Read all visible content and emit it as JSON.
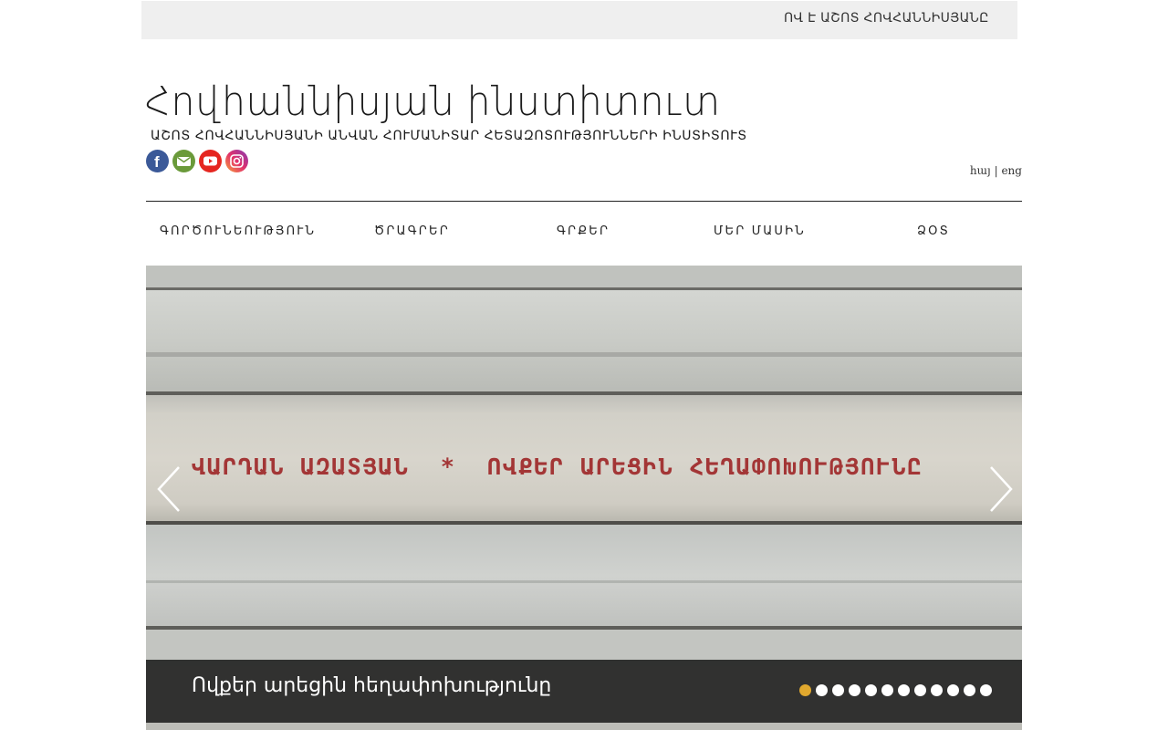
{
  "topbar": {
    "link": "ՈՎ Է ԱՇՈՏ ՀՈՎՀԱՆՆԻՍՅԱՆԸ"
  },
  "header": {
    "title": "Հովհաննիսյան ինստիտուտ",
    "subtitle": "ԱՇՈՏ ՀՈՎՀԱՆՆԻՍՅԱՆԻ ԱՆՎԱՆ ՀՈՒՄԱՆԻՏԱՐ ՀԵՏԱԶՈՏՈՒԹՅՈՒՆՆԵՐԻ ԻՆՍՏԻՏՈՒՏ",
    "social": [
      {
        "icon": "facebook-icon",
        "color": "#3b5998"
      },
      {
        "icon": "email-icon",
        "color": "#6a9a3a"
      },
      {
        "icon": "youtube-icon",
        "color": "#e52620"
      },
      {
        "icon": "instagram-icon",
        "color": "#c13584"
      }
    ],
    "lang": {
      "hy": "հայ",
      "separator": "|",
      "en": "eng"
    }
  },
  "nav": {
    "items": [
      {
        "label": "ԳՈՐԾՈՒՆԵՈՒԹՅՈՒՆ"
      },
      {
        "label": "ԾՐԱԳՐԵՐ"
      },
      {
        "label": "ԳՐՔԵՐ"
      },
      {
        "label": "ՄԵՐ ՄԱՍԻՆ"
      },
      {
        "label": "ՁՕՏ"
      }
    ]
  },
  "slider": {
    "spine_text": "ՎԱՐԴԱՆ ԱԶԱՏՅԱՆ  *  ՈՎՔԵՐ ԱՐԵՑԻՆ ՀԵՂԱՓՈԽՈՒԹՅՈՒՆԸ",
    "caption": "Ովքեր արեցին հեղափոխությունը",
    "slide_count": 12,
    "active_index": 0,
    "active_dot_color": "#e0a82e"
  }
}
